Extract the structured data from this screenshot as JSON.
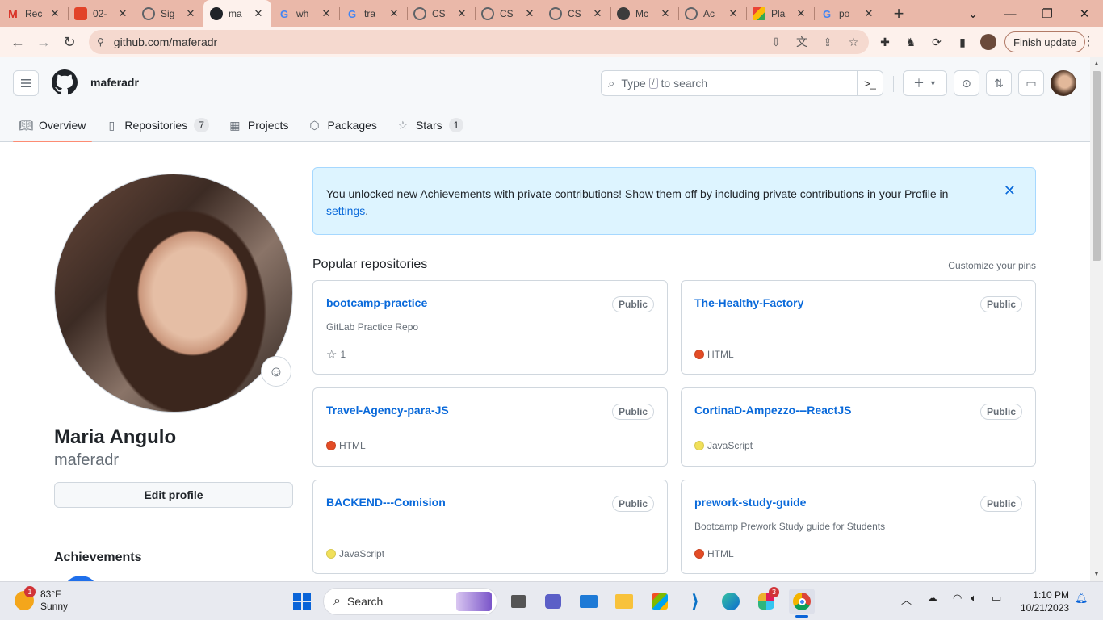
{
  "browser": {
    "tabs": [
      {
        "title": "Rec",
        "favicon": "gmail-icon",
        "color": "#d93025"
      },
      {
        "title": "02-",
        "favicon": "gitlab-icon",
        "color": "#e24329"
      },
      {
        "title": "Sig",
        "favicon": "globe-icon",
        "color": "#5f6368"
      },
      {
        "title": "ma",
        "favicon": "github-icon",
        "color": "#1f2328",
        "active": true
      },
      {
        "title": "wh",
        "favicon": "google-icon",
        "color": "#4285f4"
      },
      {
        "title": "tra",
        "favicon": "google-icon",
        "color": "#4285f4"
      },
      {
        "title": "CS",
        "favicon": "globe-icon",
        "color": "#5f6368"
      },
      {
        "title": "CS",
        "favicon": "globe-icon",
        "color": "#5f6368"
      },
      {
        "title": "CS",
        "favicon": "globe-icon",
        "color": "#5f6368"
      },
      {
        "title": "Mc",
        "favicon": "mongodb-icon",
        "color": "#3c3c3c"
      },
      {
        "title": "Ac",
        "favicon": "globe-icon",
        "color": "#5f6368"
      },
      {
        "title": "Pla",
        "favicon": "platzi-icon",
        "color": "#34a853"
      },
      {
        "title": "po",
        "favicon": "google-icon",
        "color": "#4285f4"
      }
    ],
    "url": "github.com/maferadr",
    "finish_update": "Finish update"
  },
  "github": {
    "username": "maferadr",
    "search_prefix": "Type",
    "search_slash": "/",
    "search_suffix": "to search",
    "nav": [
      {
        "label": "Overview",
        "icon": "book-icon",
        "active": true
      },
      {
        "label": "Repositories",
        "icon": "repo-icon",
        "count": "7"
      },
      {
        "label": "Projects",
        "icon": "table-icon"
      },
      {
        "label": "Packages",
        "icon": "package-icon"
      },
      {
        "label": "Stars",
        "icon": "star-icon",
        "count": "1"
      }
    ]
  },
  "profile": {
    "full_name": "Maria Angulo",
    "login": "maferadr",
    "edit_label": "Edit profile",
    "achievements_title": "Achievements"
  },
  "flash": {
    "message": "You unlocked new Achievements with private contributions! Show them off by including private contributions in your Profile in",
    "link": "settings",
    "end": "."
  },
  "popular": {
    "title": "Popular repositories",
    "customize": "Customize your pins",
    "repos": [
      {
        "name": "bootcamp-practice",
        "visibility": "Public",
        "description": "GitLab Practice Repo",
        "stars": "1"
      },
      {
        "name": "The-Healthy-Factory",
        "visibility": "Public",
        "description": "",
        "language": "HTML",
        "lang_color": "#e34c26"
      },
      {
        "name": "Travel-Agency-para-JS",
        "visibility": "Public",
        "description": "",
        "language": "HTML",
        "lang_color": "#e34c26"
      },
      {
        "name": "CortinaD-Ampezzo---ReactJS",
        "visibility": "Public",
        "description": "",
        "language": "JavaScript",
        "lang_color": "#f1e05a"
      },
      {
        "name": "BACKEND---Comision",
        "visibility": "Public",
        "description": "",
        "language": "JavaScript",
        "lang_color": "#f1e05a"
      },
      {
        "name": "prework-study-guide",
        "visibility": "Public",
        "description": "Bootcamp Prework Study guide for Students",
        "language": "HTML",
        "lang_color": "#e34c26"
      }
    ]
  },
  "taskbar": {
    "weather_temp": "83°F",
    "weather_cond": "Sunny",
    "weather_badge": "1",
    "search_label": "Search",
    "slack_badge": "3",
    "time": "1:10 PM",
    "date": "10/21/2023"
  }
}
